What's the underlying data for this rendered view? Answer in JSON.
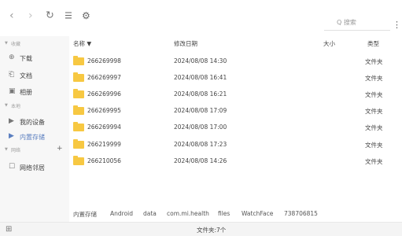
{
  "toolbar": {
    "back_icon": "chevron-left-icon",
    "forward_icon": "chevron-right-icon",
    "refresh_icon": "refresh-icon",
    "view_icon": "list-view-icon",
    "settings_icon": "gear-icon",
    "search_placeholder": "Q 搜索",
    "more_icon": "more-vertical-icon"
  },
  "sidebar": {
    "sections": [
      {
        "label": "收藏"
      },
      {
        "label": "本地"
      },
      {
        "label": "网络"
      }
    ],
    "favorites": [
      {
        "label": "下载",
        "icon": "download-icon"
      },
      {
        "label": "文档",
        "icon": "document-icon"
      },
      {
        "label": "相册",
        "icon": "image-icon"
      }
    ],
    "local": [
      {
        "label": "我的设备",
        "icon": "caret-right-icon"
      },
      {
        "label": "内置存储",
        "icon": "caret-right-icon",
        "active": true
      }
    ],
    "network_add": "+",
    "network": [
      {
        "label": "网络邻居",
        "icon": "network-icon"
      }
    ]
  },
  "columns": {
    "name": "名称 ▼",
    "modified": "修改日期",
    "size": "大小",
    "type": "类型"
  },
  "files": [
    {
      "name": "266269998",
      "modified": "2024/08/08 14:30",
      "type": "文件夹"
    },
    {
      "name": "266269997",
      "modified": "2024/08/08 16:41",
      "type": "文件夹"
    },
    {
      "name": "266269996",
      "modified": "2024/08/08 16:21",
      "type": "文件夹"
    },
    {
      "name": "266269995",
      "modified": "2024/08/08 17:09",
      "type": "文件夹"
    },
    {
      "name": "266269994",
      "modified": "2024/08/08 17:00",
      "type": "文件夹"
    },
    {
      "name": "266219999",
      "modified": "2024/08/08 17:23",
      "type": "文件夹"
    },
    {
      "name": "266210056",
      "modified": "2024/08/08 14:26",
      "type": "文件夹"
    }
  ],
  "breadcrumb": [
    "内置存储",
    "Android",
    "data",
    "com.mi.health",
    "files",
    "WatchFace",
    "738706815"
  ],
  "status": {
    "text": "文件夹:7个",
    "collapse_icon": "sidebar-toggle-icon"
  },
  "colors": {
    "folder": "#f7c842",
    "accent": "#5b7fc0",
    "sidebar_bg": "#f7f7f7"
  }
}
